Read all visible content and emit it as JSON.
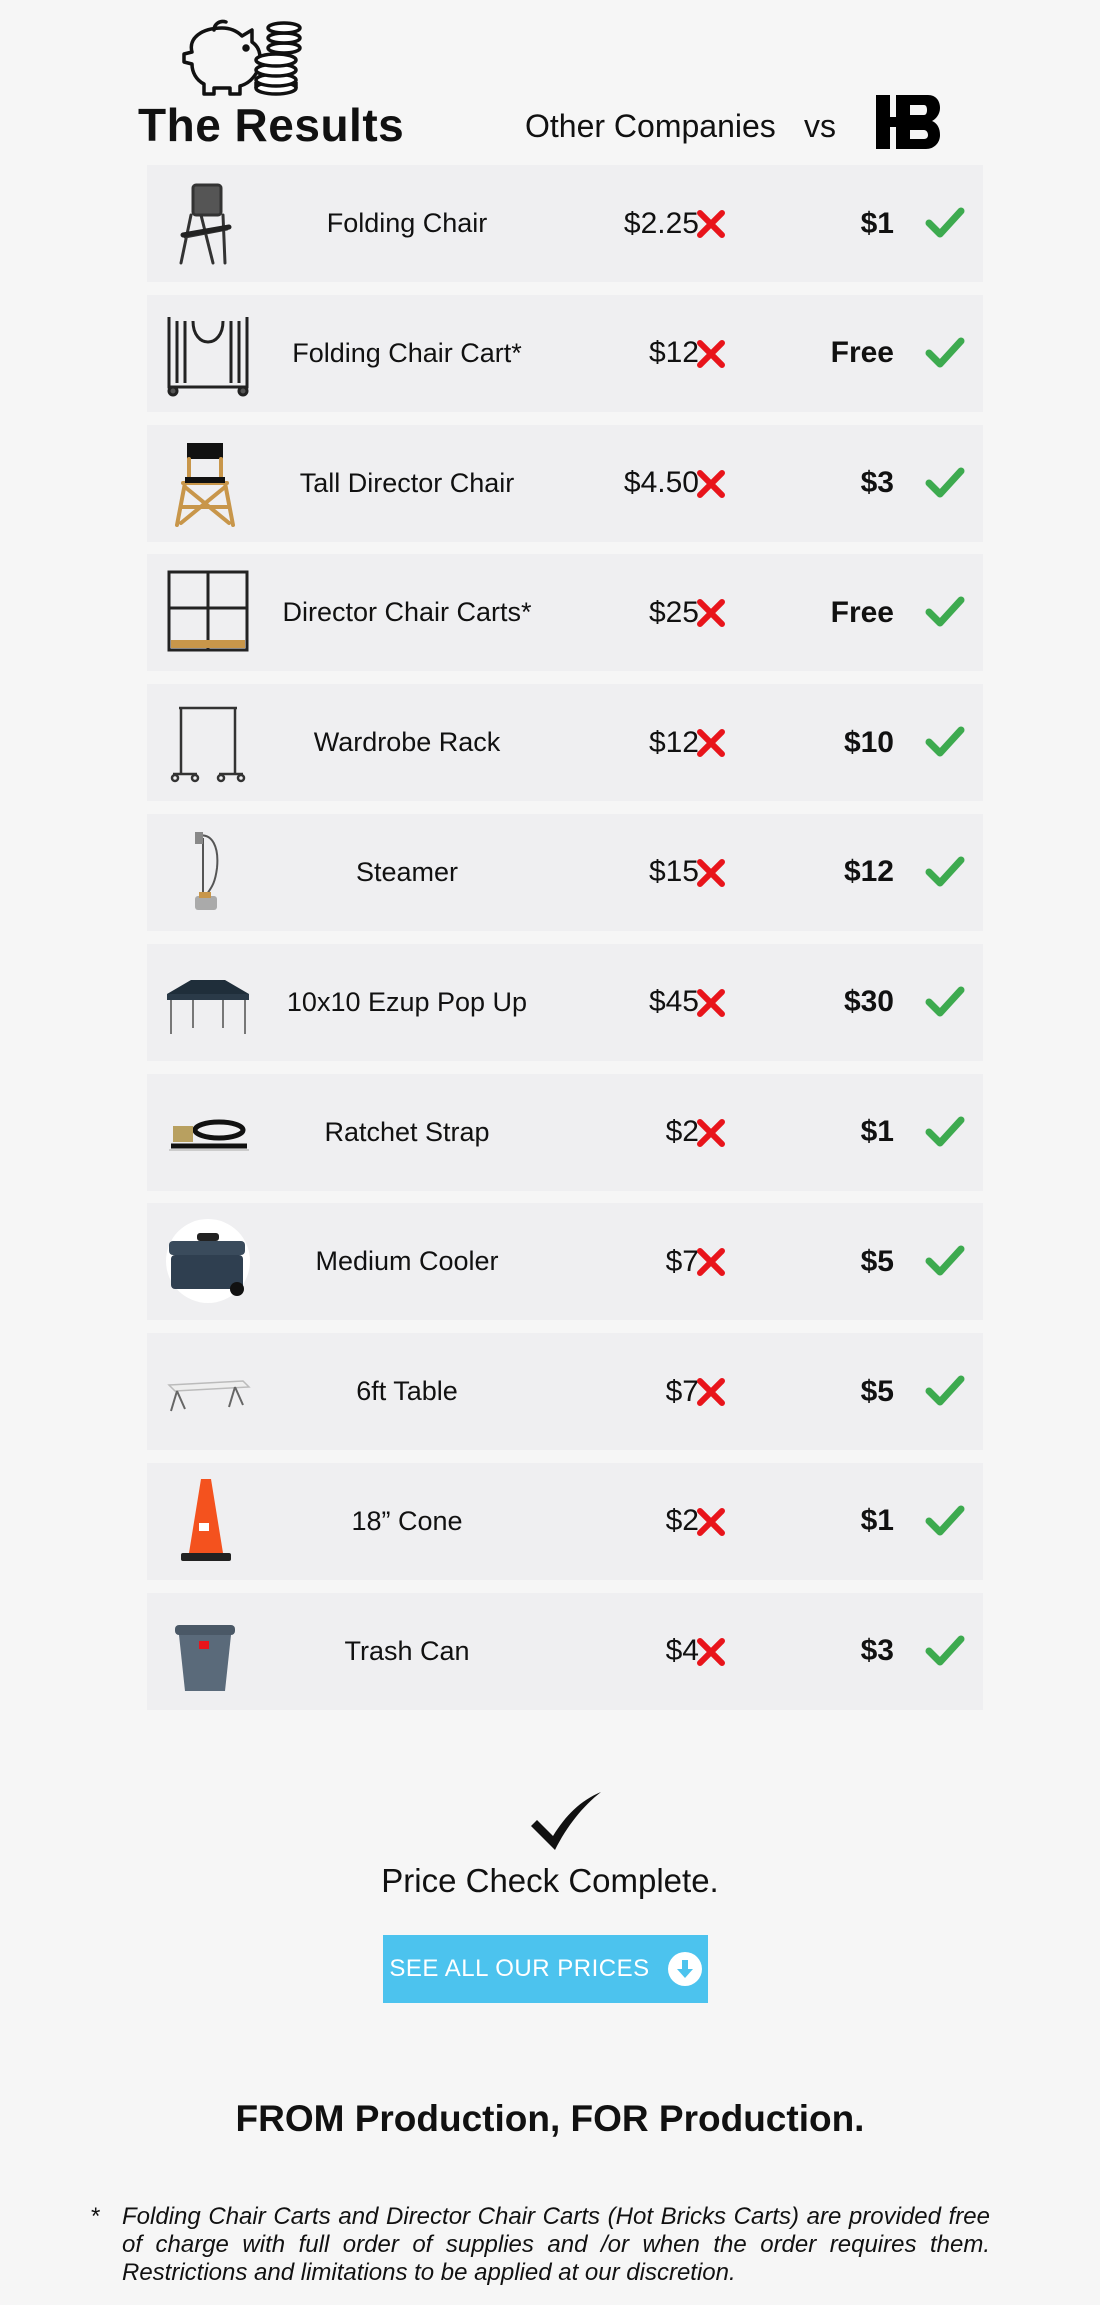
{
  "header": {
    "title": "The Results",
    "other_label": "Other Companies",
    "vs_label": "vs",
    "icon": "piggy-bank-coins-icon",
    "logo_icon": "hb-logo"
  },
  "rows": [
    {
      "name": "Folding Chair",
      "other_price": "$2.25",
      "hb_price": "$1",
      "icon": "folding-chair-icon"
    },
    {
      "name": "Folding Chair Cart*",
      "other_price": "$12",
      "hb_price": "Free",
      "icon": "chair-cart-icon"
    },
    {
      "name": "Tall Director Chair",
      "other_price": "$4.50",
      "hb_price": "$3",
      "icon": "director-chair-icon"
    },
    {
      "name": "Director Chair Carts*",
      "other_price": "$25",
      "hb_price": "Free",
      "icon": "director-cart-icon"
    },
    {
      "name": "Wardrobe Rack",
      "other_price": "$12",
      "hb_price": "$10",
      "icon": "wardrobe-rack-icon"
    },
    {
      "name": "Steamer",
      "other_price": "$15",
      "hb_price": "$12",
      "icon": "steamer-icon"
    },
    {
      "name": "10x10 Ezup Pop Up",
      "other_price": "$45",
      "hb_price": "$30",
      "icon": "popup-tent-icon"
    },
    {
      "name": "Ratchet Strap",
      "other_price": "$2",
      "hb_price": "$1",
      "icon": "ratchet-strap-icon"
    },
    {
      "name": "Medium Cooler",
      "other_price": "$7",
      "hb_price": "$5",
      "icon": "cooler-icon"
    },
    {
      "name": "6ft Table",
      "other_price": "$7",
      "hb_price": "$5",
      "icon": "table-icon"
    },
    {
      "name": "18” Cone",
      "other_price": "$2",
      "hb_price": "$1",
      "icon": "cone-icon"
    },
    {
      "name": "Trash Can",
      "other_price": "$4",
      "hb_price": "$3",
      "icon": "trash-can-icon"
    }
  ],
  "complete": {
    "text": "Price Check Complete.",
    "icon": "big-check-icon"
  },
  "cta": {
    "label": "SEE ALL OUR PRICES",
    "icon": "arrow-down-circle-icon"
  },
  "tagline": "FROM Production, FOR Production.",
  "footnote": {
    "star": "*",
    "text": "Folding Chair Carts and Director Chair Carts (Hot Bricks Carts) are provided free of charge with full order of supplies and /or when the order requires them. Restrictions and limitations to be applied at our discretion."
  },
  "colors": {
    "cross": "#e8141b",
    "check": "#3daa4f",
    "cta": "#4cc3ee",
    "row_bg": "#efeff1",
    "page_bg": "#f6f6f6"
  }
}
